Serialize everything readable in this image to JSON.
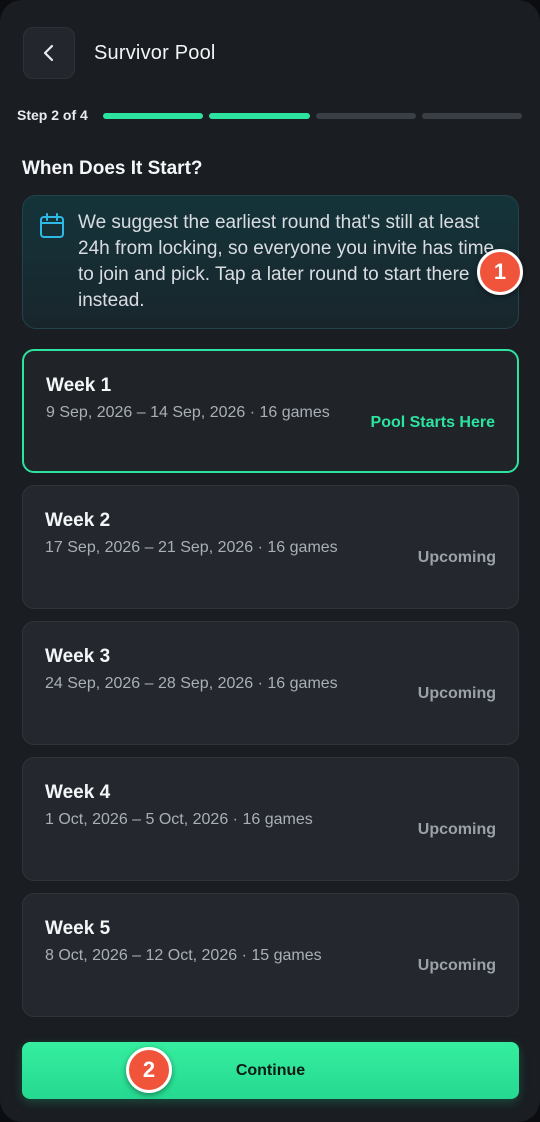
{
  "header": {
    "title": "Survivor Pool"
  },
  "progress": {
    "label": "Step 2 of 4",
    "current_step": 2,
    "total_steps": 4
  },
  "section": {
    "title": "When Does It Start?"
  },
  "info": {
    "icon": "calendar-icon",
    "text": "We suggest the earliest round that's still at least 24h from locking, so everyone you invite has time to join and pick. Tap a later round to start there instead."
  },
  "weeks": [
    {
      "name": "Week 1",
      "dates": "9 Sep, 2026 – 14 Sep, 2026 · 16 games",
      "status": "Pool Starts Here",
      "selected": true
    },
    {
      "name": "Week 2",
      "dates": "17 Sep, 2026 – 21 Sep, 2026 · 16 games",
      "status": "Upcoming",
      "selected": false
    },
    {
      "name": "Week 3",
      "dates": "24 Sep, 2026 – 28 Sep, 2026 · 16 games",
      "status": "Upcoming",
      "selected": false
    },
    {
      "name": "Week 4",
      "dates": "1 Oct, 2026 – 5 Oct, 2026 · 16 games",
      "status": "Upcoming",
      "selected": false
    },
    {
      "name": "Week 5",
      "dates": "8 Oct, 2026 – 12 Oct, 2026 · 15 games",
      "status": "Upcoming",
      "selected": false
    }
  ],
  "footer": {
    "continue_label": "Continue"
  },
  "annotations": {
    "badge_1": "1",
    "badge_2": "2"
  },
  "colors": {
    "accent": "#2de3a0",
    "badge": "#f0543a",
    "background": "#1a1d22",
    "card": "#24282e"
  }
}
